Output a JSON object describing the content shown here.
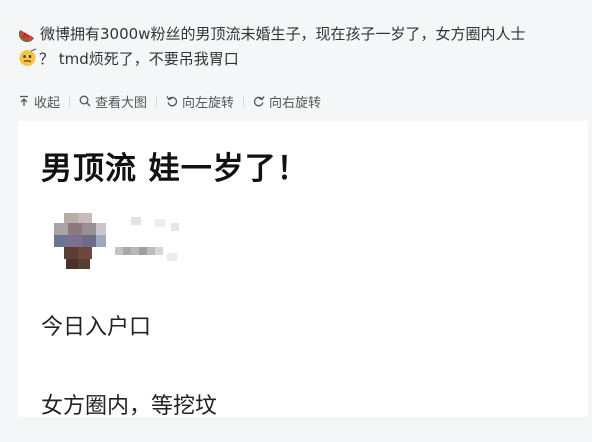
{
  "post": {
    "text_line1": "微博拥有3000w粉丝的男顶流未婚生子，现在孩子一岁了，女方圈内人士",
    "text_line2": "？ tmd烦死了，不要吊我胃口"
  },
  "toolbar": {
    "collapse": "收起",
    "view_large": "查看大图",
    "rotate_left": "向左旋转",
    "rotate_right": "向右旋转"
  },
  "image_card": {
    "title": "男顶流 娃一岁了！",
    "line1": "今日入户口",
    "line2": "女方圈内，等挖坟"
  },
  "icons": {
    "emoji1": "watermelon-emoji",
    "emoji2": "thinking-face-emoji",
    "collapse": "arrow-up-icon",
    "view_large": "magnifier-icon",
    "rotate_left": "rotate-left-icon",
    "rotate_right": "rotate-right-icon"
  }
}
